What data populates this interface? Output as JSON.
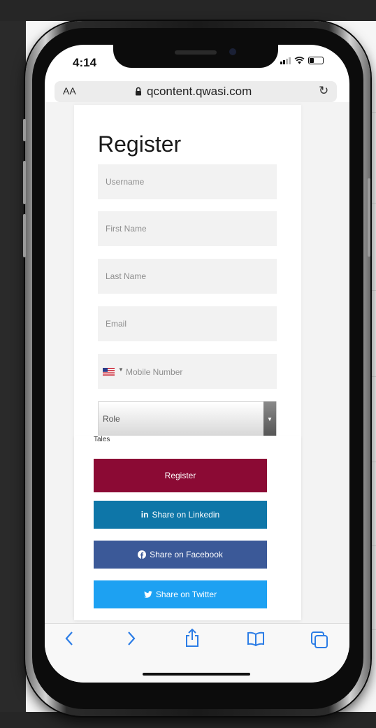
{
  "status": {
    "time": "4:14"
  },
  "browser": {
    "text_size_label": "AA",
    "url": "qcontent.qwasi.com"
  },
  "form": {
    "title": "Register",
    "username_placeholder": "Username",
    "first_name_placeholder": "First Name",
    "last_name_placeholder": "Last Name",
    "email_placeholder": "Email",
    "mobile_placeholder": "Mobile Number",
    "role_label": "Role",
    "cutoff_text": "Tales",
    "register_label": "Register",
    "linkedin_glyph": "in",
    "linkedin_label": "Share on Linkedin",
    "facebook_label": "Share on Facebook",
    "twitter_label": "Share on Twitter"
  },
  "colors": {
    "register": "#8b0a34",
    "linkedin": "#0e76a8",
    "facebook": "#3b5998",
    "twitter": "#1da1f2",
    "ios_blue": "#2c7de6"
  },
  "icons": {
    "lock": "lock-icon",
    "reload": "reload-icon",
    "back": "chevron-left-icon",
    "forward": "chevron-right-icon",
    "share": "share-icon",
    "bookmarks": "book-icon",
    "tabs": "tabs-icon",
    "flag": "us-flag-icon",
    "facebook": "facebook-icon",
    "twitter": "twitter-icon"
  }
}
